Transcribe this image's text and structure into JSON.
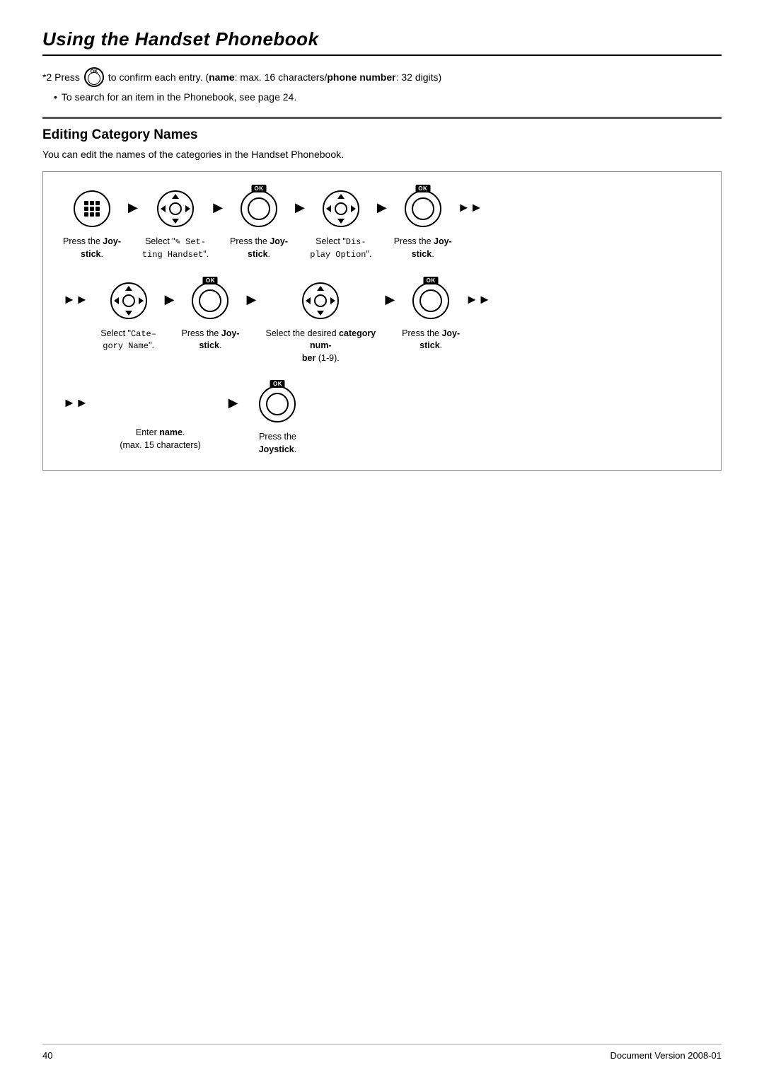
{
  "page": {
    "title": "Using the Handset Phonebook",
    "footer_page": "40",
    "footer_doc": "Document Version 2008-01"
  },
  "notes": {
    "note1_prefix": "*2  Press",
    "note1_suffix": "to confirm each entry. (",
    "note1_name": "name",
    "note1_middle": ": max. 16 characters/",
    "note1_phone": "phone number",
    "note1_end": ": 32 digits)",
    "bullet1": "To search for an item in the Phonebook, see page 24."
  },
  "section": {
    "title": "Editing Category Names",
    "desc": "You can edit the names of the categories in the Handset Phonebook."
  },
  "steps": {
    "row1": [
      {
        "type": "menu",
        "caption": "Press the Joy-\nstick."
      },
      {
        "arrow": "single"
      },
      {
        "type": "joystick",
        "caption": "Select \"• Set-\nting Handset\"."
      },
      {
        "arrow": "single"
      },
      {
        "type": "ok",
        "caption": "Press the Joy-\nstick."
      },
      {
        "arrow": "single"
      },
      {
        "type": "joystick",
        "caption": "Select \"Dis-\nplay Option\"."
      },
      {
        "arrow": "single"
      },
      {
        "type": "ok",
        "caption": "Press the Joy-\nstick."
      },
      {
        "arrow": "double_end"
      }
    ],
    "row2": [
      {
        "arrow": "double_start"
      },
      {
        "type": "joystick",
        "caption": "Select \"Cate-\ngory Name\"."
      },
      {
        "arrow": "single"
      },
      {
        "type": "ok",
        "caption": "Press the Joy-\nstick."
      },
      {
        "arrow": "single"
      },
      {
        "type": "joystick_ud",
        "caption": "Select the desired category num-\nber (1-9)."
      },
      {
        "arrow": "single"
      },
      {
        "type": "ok",
        "caption": "Press the Joy-\nstick."
      },
      {
        "arrow": "double_end"
      }
    ],
    "row3_left": "Enter name.\n(max. 15 characters)",
    "row3_ok_caption": "Press the Joystick."
  },
  "icons": {
    "ok_badge": "OK",
    "menu_badge": ""
  }
}
